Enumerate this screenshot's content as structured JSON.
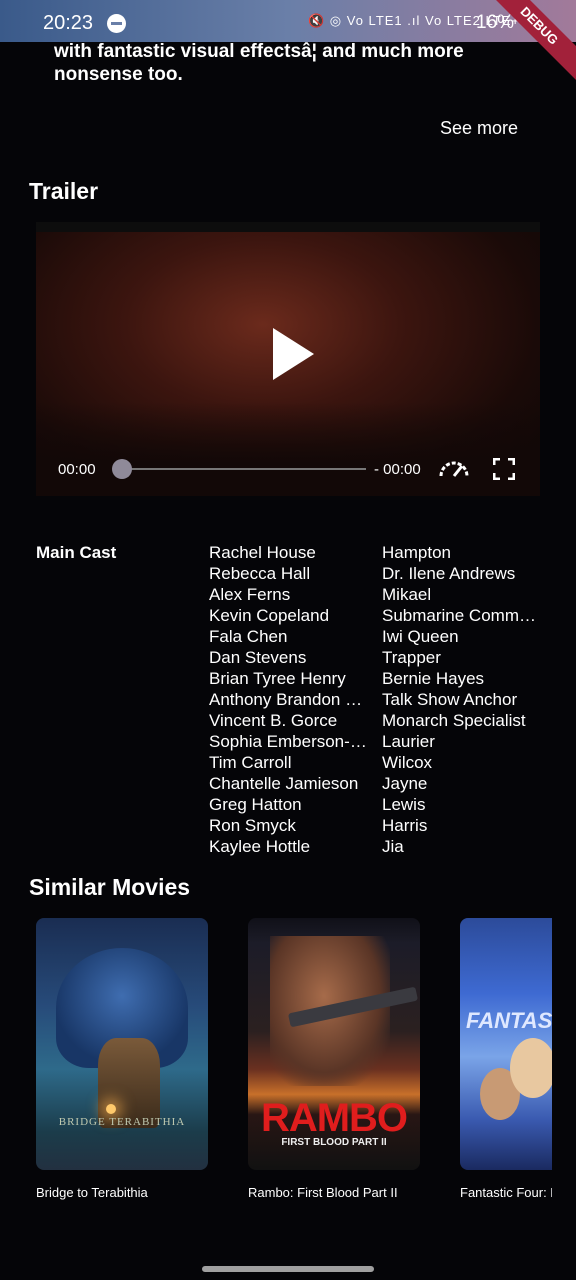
{
  "status_bar": {
    "time": "20:23",
    "network_icons": "🔇 ◎ Vo LTE1 .ıl Vo LTE2 LTE+ .ıl",
    "battery": "16%",
    "debug_banner": "DEBUG"
  },
  "overview": {
    "text": "with fantastic visual effectsâ¦ and much more nonsense too.",
    "see_more_label": "See more"
  },
  "trailer": {
    "title": "Trailer",
    "position": "00:00",
    "remaining": "- 00:00",
    "progress": 0
  },
  "cast": {
    "label": "Main Cast",
    "actors": [
      "Rachel House",
      "Rebecca Hall",
      "Alex Ferns",
      "Kevin Copeland",
      "Fala Chen",
      "Dan Stevens",
      "Brian Tyree Henry",
      "Anthony Brandon Wong",
      "Vincent B. Gorce",
      "Sophia Emberson-Bain",
      "Tim Carroll",
      "Chantelle Jamieson",
      "Greg Hatton",
      "Ron Smyck",
      "Kaylee Hottle"
    ],
    "roles": [
      "Hampton",
      "Dr. Ilene Andrews",
      "Mikael",
      "Submarine Commander",
      "Iwi Queen",
      "Trapper",
      "Bernie Hayes",
      "Talk Show Anchor",
      "Monarch Specialist",
      "Laurier",
      "Wilcox",
      "Jayne",
      "Lewis",
      "Harris",
      "Jia"
    ]
  },
  "similar": {
    "title": "Similar Movies",
    "movies": [
      {
        "title": "Bridge to Terabithia",
        "poster_text": "BRIDGE  TERABITHIA"
      },
      {
        "title": "Rambo: First Blood Part II",
        "poster_text": "RAMBO",
        "poster_sub": "FIRST BLOOD PART II"
      },
      {
        "title": "Fantastic Four: Rise of the Silver Surfer",
        "poster_text": "FANTAS"
      }
    ]
  }
}
